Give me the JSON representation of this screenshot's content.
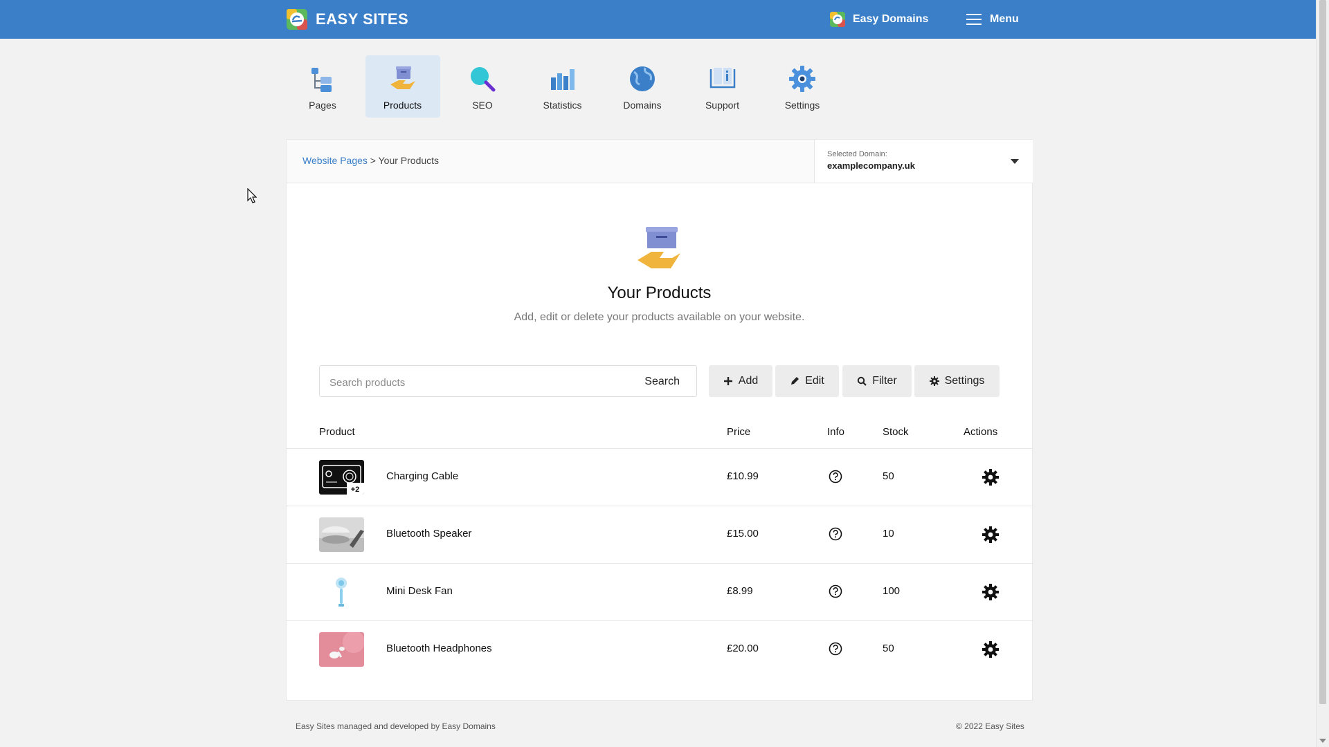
{
  "header": {
    "brand": "EASY SITES",
    "domains_link": "Easy Domains",
    "menu_label": "Menu"
  },
  "nav": {
    "items": [
      {
        "label": "Pages"
      },
      {
        "label": "Products",
        "active": true
      },
      {
        "label": "SEO"
      },
      {
        "label": "Statistics"
      },
      {
        "label": "Domains"
      },
      {
        "label": "Support"
      },
      {
        "label": "Settings"
      }
    ]
  },
  "breadcrumb": {
    "parent": "Website Pages",
    "separator": ">",
    "current": "Your Products"
  },
  "domain_select": {
    "label": "Selected Domain:",
    "value": "examplecompany.uk"
  },
  "hero": {
    "title": "Your Products",
    "subtitle": "Add, edit or delete your products available on your website."
  },
  "search": {
    "placeholder": "Search products",
    "button": "Search"
  },
  "toolbar": {
    "add": "Add",
    "edit": "Edit",
    "filter": "Filter",
    "settings": "Settings"
  },
  "table": {
    "headers": {
      "product": "Product",
      "price": "Price",
      "info": "Info",
      "stock": "Stock",
      "actions": "Actions"
    },
    "rows": [
      {
        "name": "Charging Cable",
        "price": "£10.99",
        "stock": "50",
        "thumb_badge": "+2"
      },
      {
        "name": "Bluetooth Speaker",
        "price": "£15.00",
        "stock": "10"
      },
      {
        "name": "Mini Desk Fan",
        "price": "£8.99",
        "stock": "100"
      },
      {
        "name": "Bluetooth Headphones",
        "price": "£20.00",
        "stock": "50"
      }
    ]
  },
  "footer": {
    "left": "Easy Sites managed and developed by Easy Domains",
    "right": "© 2022 Easy Sites"
  },
  "colors": {
    "primary": "#3a7fc8",
    "nav_active_bg": "#dde8f5",
    "product_box": "#7f8fd1",
    "product_hand": "#f0b43c"
  }
}
